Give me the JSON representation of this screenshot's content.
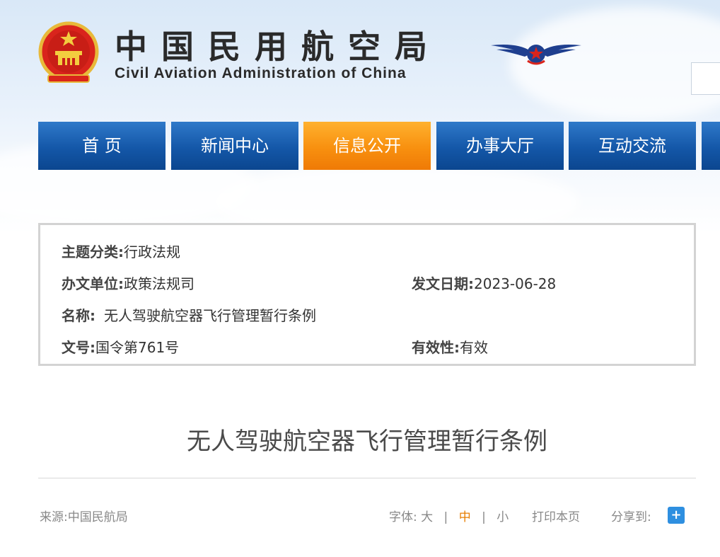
{
  "header": {
    "title_cn": "中国民用航空局",
    "title_en": "Civil Aviation Administration of China",
    "emblem_icon": "national-emblem-icon",
    "logo_icon": "caac-wings-logo-icon"
  },
  "nav": {
    "items": [
      {
        "label": "首 页"
      },
      {
        "label": "新闻中心"
      },
      {
        "label": "信息公开"
      },
      {
        "label": "办事大厅"
      },
      {
        "label": "互动交流"
      }
    ],
    "active_index": 2,
    "colors": {
      "normal": "#1457a8",
      "active": "#f8900f"
    }
  },
  "info": {
    "topic_label": "主题分类:",
    "topic_value": "行政法规",
    "unit_label": "办文单位:",
    "unit_value": "政策法规司",
    "date_label": "发文日期:",
    "date_value": "2023-06-28",
    "name_label": "名称:",
    "name_value": "无人驾驶航空器飞行管理暂行条例",
    "docno_label": "文号:",
    "docno_value": "国令第761号",
    "validity_label": "有效性:",
    "validity_value": "有效"
  },
  "article": {
    "title": "无人驾驶航空器飞行管理暂行条例"
  },
  "meta": {
    "source": "来源:中国民航局",
    "font_label": "字体:",
    "font_large": "大",
    "font_medium": "中",
    "font_small": "小",
    "separator": "|",
    "print_label": "打印本页",
    "share_label": "分享到:",
    "share_icon": "plus-icon",
    "share_glyph": "+"
  }
}
